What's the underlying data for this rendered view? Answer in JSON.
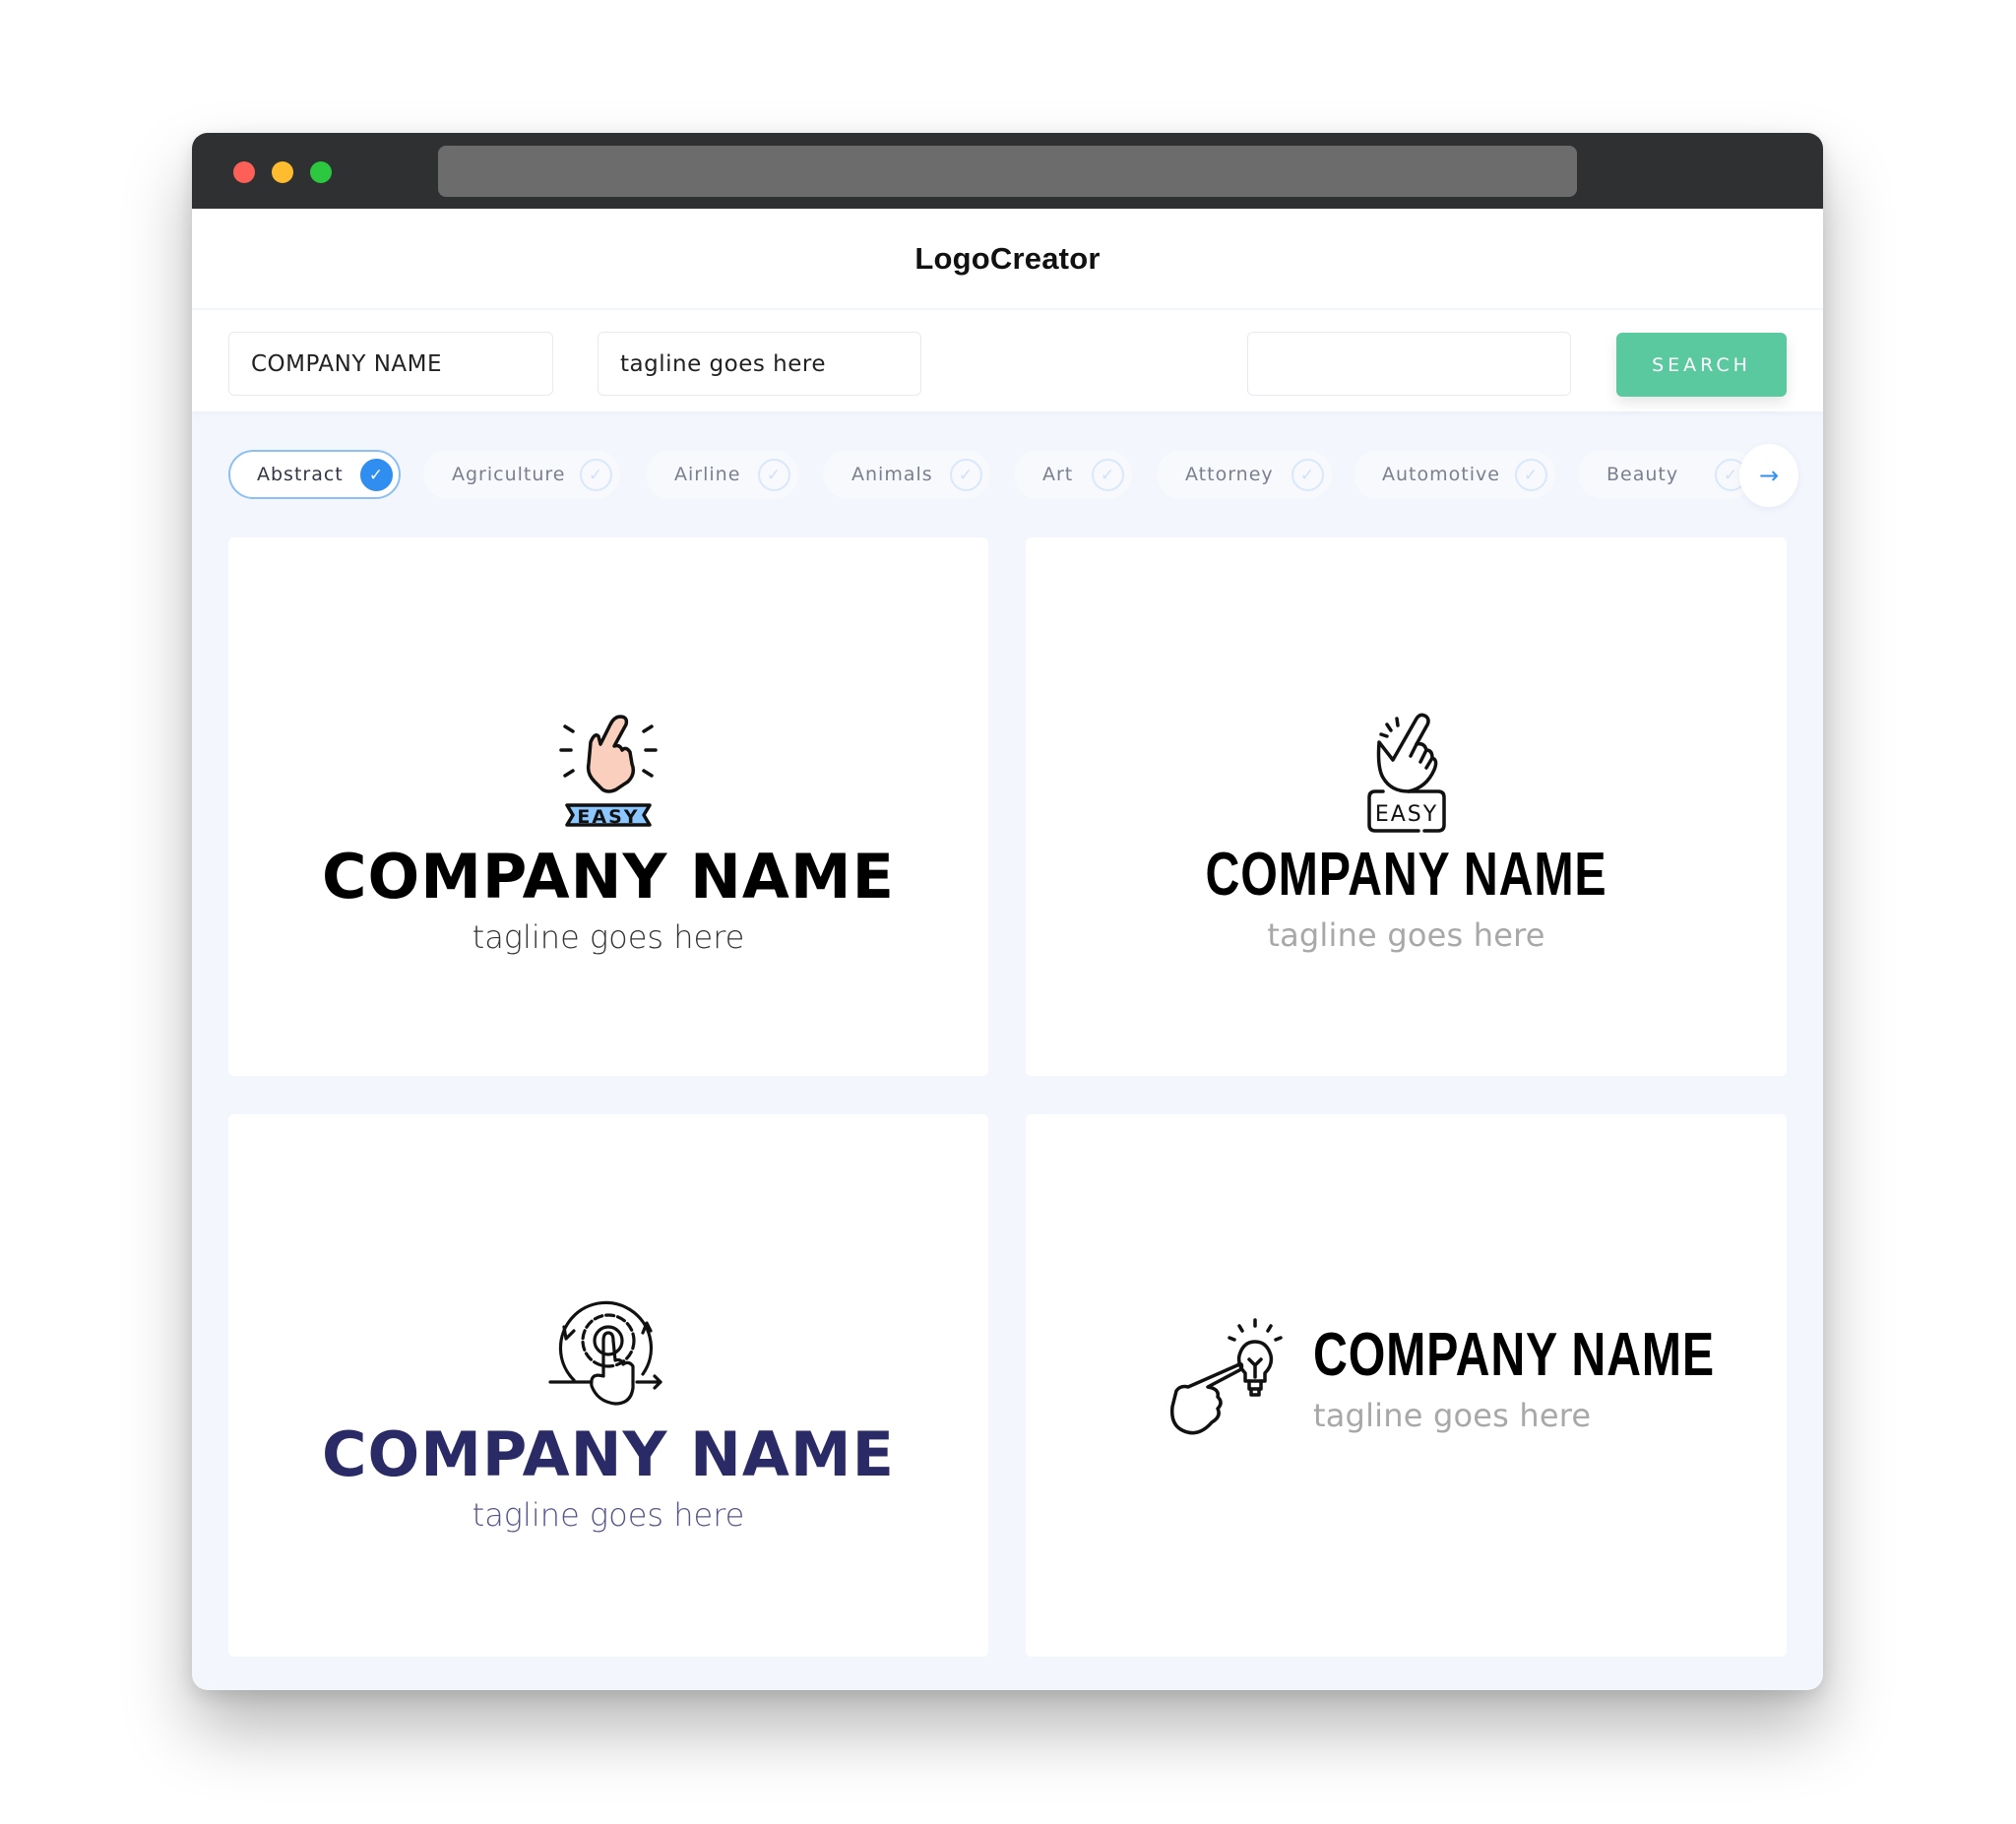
{
  "window": {
    "traffic_lights": [
      "close",
      "minimize",
      "maximize"
    ],
    "colors": {
      "close": "#fe5f57",
      "minimize": "#febc2e",
      "maximize": "#2bc840",
      "titlebar": "#2f3032",
      "urlbar": "#6c6c6c"
    }
  },
  "header": {
    "brand": "LogoCreator"
  },
  "search": {
    "company_value": "COMPANY NAME",
    "tagline_value": "tagline goes here",
    "extra_value": "",
    "button_label": "SEARCH",
    "button_color": "#5bc9a0"
  },
  "categories": {
    "items": [
      {
        "label": "Abstract",
        "selected": true
      },
      {
        "label": "Agriculture",
        "selected": false
      },
      {
        "label": "Airline",
        "selected": false
      },
      {
        "label": "Animals",
        "selected": false
      },
      {
        "label": "Art",
        "selected": false
      },
      {
        "label": "Attorney",
        "selected": false
      },
      {
        "label": "Automotive",
        "selected": false
      },
      {
        "label": "Beauty",
        "selected": false
      }
    ],
    "check_glyph": "✓",
    "next_glyph": "→",
    "accent": "#2f8ef0"
  },
  "logos": [
    {
      "icon": "tap-hand-easy-icon",
      "badge": "EASY",
      "name": "COMPANY NAME",
      "tagline": "tagline goes here",
      "name_color": "#000000",
      "tagline_color": "#333333",
      "icon_colors": {
        "hand": "#fbcfbd",
        "badge": "#8cc8ff"
      }
    },
    {
      "icon": "tap-hand-easy-outline-icon",
      "badge": "EASY",
      "name": "COMPANY NAME",
      "tagline": "tagline goes here",
      "name_color": "#000000",
      "tagline_color": "#a8a8a8"
    },
    {
      "icon": "touch-gear-cycle-icon",
      "name": "COMPANY NAME",
      "tagline": "tagline goes here",
      "name_color": "#2a2a66",
      "tagline_color": "#54548a"
    },
    {
      "icon": "pointing-hand-lightbulb-icon",
      "name": "COMPANY NAME",
      "tagline": "tagline goes here",
      "name_color": "#000000",
      "tagline_color": "#a8a8a8"
    }
  ]
}
